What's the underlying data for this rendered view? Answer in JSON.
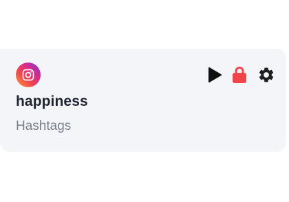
{
  "feed": {
    "platform_icon": "instagram-icon",
    "title": "happiness",
    "type_label": "Hashtags"
  },
  "actions": {
    "play_icon": "play-icon",
    "lock_icon": "lock-icon",
    "settings_icon": "gear-icon"
  },
  "colors": {
    "card_background": "#f3f5f8",
    "title_text": "#1f2430",
    "subtitle_text": "#7b818c",
    "play_icon": "#111111",
    "lock_icon": "#f2454b",
    "gear_icon": "#1f1f1f"
  }
}
